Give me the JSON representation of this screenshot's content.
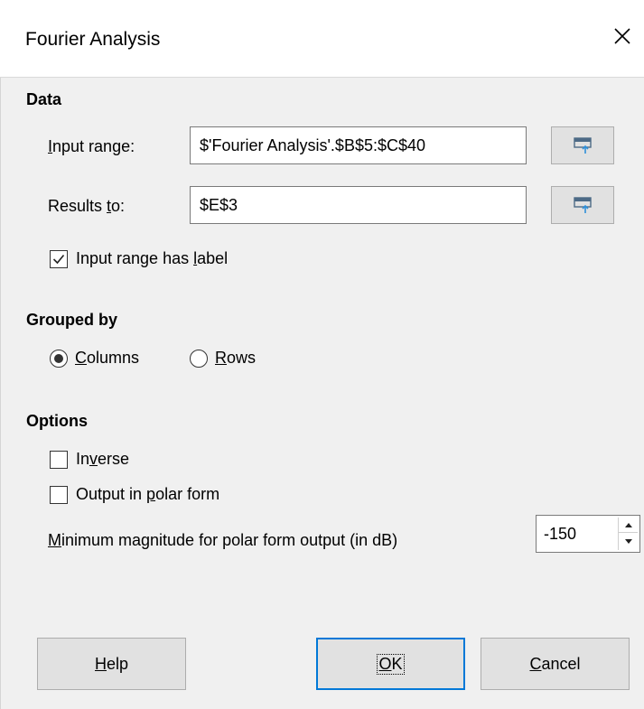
{
  "dialog": {
    "title": "Fourier Analysis"
  },
  "data_section": {
    "heading": "Data",
    "input_range": {
      "label_pre": "",
      "label_mnemonic": "I",
      "label_post": "nput range:",
      "value": "$'Fourier Analysis'.$B$5:$C$40"
    },
    "results_to": {
      "label_pre": "Results ",
      "label_mnemonic": "t",
      "label_post": "o:",
      "value": "$E$3"
    },
    "has_label": {
      "label_pre": "Input range has ",
      "label_mnemonic": "l",
      "label_post": "abel",
      "checked": true
    }
  },
  "grouped_section": {
    "heading": "Grouped by",
    "columns": {
      "label_pre": "",
      "label_mnemonic": "C",
      "label_post": "olumns",
      "selected": true
    },
    "rows": {
      "label_pre": "",
      "label_mnemonic": "R",
      "label_post": "ows",
      "selected": false
    }
  },
  "options_section": {
    "heading": "Options",
    "inverse": {
      "label_pre": "In",
      "label_mnemonic": "v",
      "label_post": "erse",
      "checked": false
    },
    "polar": {
      "label_pre": "Output in ",
      "label_mnemonic": "p",
      "label_post": "olar form",
      "checked": false
    },
    "min_magnitude": {
      "label_pre": "",
      "label_mnemonic": "M",
      "label_post": "inimum magnitude for polar form output (in dB)",
      "value": "-150"
    }
  },
  "buttons": {
    "help": {
      "label_pre": "",
      "label_mnemonic": "H",
      "label_post": "elp"
    },
    "ok": {
      "label_pre": "",
      "label_mnemonic": "O",
      "label_post": "K"
    },
    "cancel": {
      "label_pre": "",
      "label_mnemonic": "C",
      "label_post": "ancel"
    }
  },
  "icons": {
    "close": "close-icon",
    "shrink": "shrink-dialog-icon",
    "spin_up": "spin-up-icon",
    "spin_down": "spin-down-icon"
  },
  "colors": {
    "accent": "#0078d7",
    "content_bg": "#f0f0f0",
    "button_bg": "#e1e1e1"
  }
}
